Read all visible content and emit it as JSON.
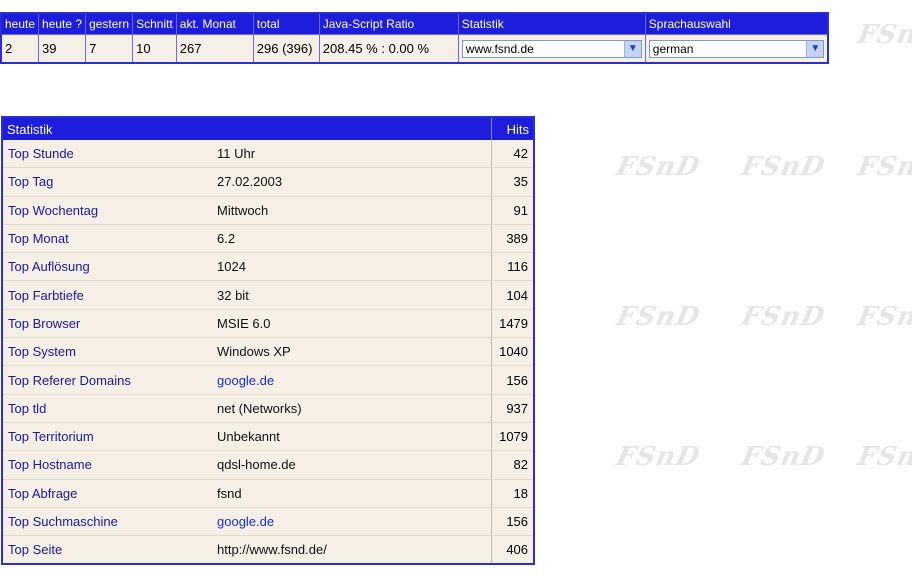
{
  "watermark": "FSnD",
  "summary": {
    "headers": [
      "heute",
      "heute ?",
      "gestern",
      "Schnitt",
      "akt. Monat",
      "total",
      "Java-Script Ratio",
      "Statistik",
      "Sprachauswahl"
    ],
    "values": [
      "2",
      "39",
      "7",
      "10",
      "267",
      "296 (396)",
      "208.45 % : 0.00 %"
    ],
    "site_select": "www.fsnd.de",
    "language_select": "german"
  },
  "stats": {
    "header": "Statistik",
    "hits_header": "Hits",
    "rows": [
      {
        "label": "Top Stunde",
        "value": "11 Uhr",
        "hits": "42"
      },
      {
        "label": "Top Tag",
        "value": "27.02.2003",
        "hits": "35"
      },
      {
        "label": "Top Wochentag",
        "value": "Mittwoch",
        "hits": "91"
      },
      {
        "label": "Top Monat",
        "value": "6.2",
        "hits": "389"
      },
      {
        "label": "Top Auflösung",
        "value": "1024",
        "hits": "116"
      },
      {
        "label": "Top Farbtiefe",
        "value": "32 bit",
        "hits": "104"
      },
      {
        "label": "Top Browser",
        "value": "MSIE 6.0",
        "hits": "1479"
      },
      {
        "label": "Top System",
        "value": "Windows XP",
        "hits": "1040"
      },
      {
        "label": "Top Referer Domains",
        "value": "google.de",
        "hits": "156"
      },
      {
        "label": "Top tld",
        "value": "net (Networks)",
        "hits": "937"
      },
      {
        "label": "Top Territorium",
        "value": "Unbekannt",
        "hits": "1079"
      },
      {
        "label": "Top Hostname",
        "value": "qdsl-home.de",
        "hits": "82"
      },
      {
        "label": "Top Abfrage",
        "value": "fsnd",
        "hits": "18"
      },
      {
        "label": "Top Suchmaschine",
        "value": "google.de",
        "hits": "156"
      },
      {
        "label": "Top Seite",
        "value": "http://www.fsnd.de/",
        "hits": "406"
      }
    ]
  }
}
